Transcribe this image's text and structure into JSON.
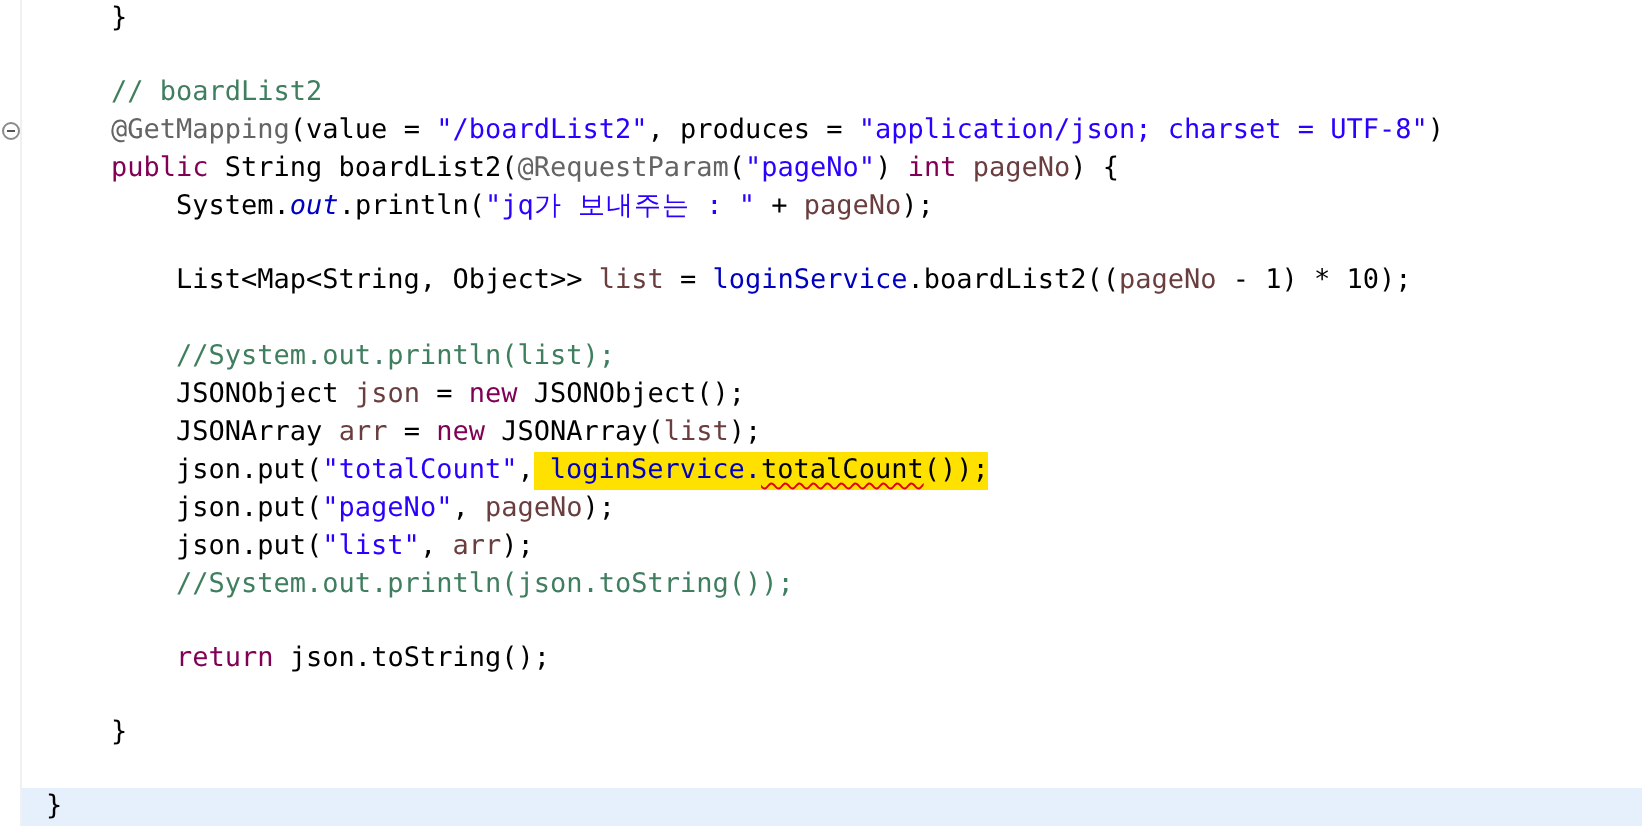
{
  "editor": {
    "lines": [
      {
        "fold": false,
        "current": false,
        "tokens": [
          {
            "text": "    }",
            "kind": "plain"
          }
        ]
      },
      {
        "fold": false,
        "current": false
      },
      {
        "fold": false,
        "current": false,
        "tokens": [
          {
            "text": "    // boardList2",
            "kind": "comment"
          }
        ]
      },
      {
        "fold": true,
        "current": false,
        "tokens": [
          {
            "text": "    @GetMapping",
            "kind": "annotation"
          },
          {
            "text": "(value = ",
            "kind": "plain"
          },
          {
            "text": "\"/boardList2\"",
            "kind": "string"
          },
          {
            "text": ", produces = ",
            "kind": "plain"
          },
          {
            "text": "\"application/json; charset = UTF-8\"",
            "kind": "string"
          },
          {
            "text": ")",
            "kind": "plain"
          }
        ]
      },
      {
        "fold": false,
        "current": false,
        "tokens": [
          {
            "text": "    public",
            "kind": "keyword"
          },
          {
            "text": " String boardList2(",
            "kind": "plain"
          },
          {
            "text": "@RequestParam",
            "kind": "annotation"
          },
          {
            "text": "(",
            "kind": "plain"
          },
          {
            "text": "\"pageNo\"",
            "kind": "string"
          },
          {
            "text": ") ",
            "kind": "plain"
          },
          {
            "text": "int",
            "kind": "keyword"
          },
          {
            "text": " pageNo",
            "kind": "variable"
          },
          {
            "text": ") {",
            "kind": "plain"
          }
        ]
      },
      {
        "fold": false,
        "current": false,
        "tokens": [
          {
            "text": "        System.",
            "kind": "plain"
          },
          {
            "text": "out",
            "kind": "static"
          },
          {
            "text": ".println(",
            "kind": "plain"
          },
          {
            "text": "\"jq가 보내주는 : \"",
            "kind": "string"
          },
          {
            "text": " + ",
            "kind": "plain"
          },
          {
            "text": "pageNo",
            "kind": "variable"
          },
          {
            "text": ");",
            "kind": "plain"
          }
        ]
      },
      {
        "fold": false,
        "current": false
      },
      {
        "fold": false,
        "current": false,
        "tokens": [
          {
            "text": "        List<Map<String, Object>> ",
            "kind": "plain"
          },
          {
            "text": "list",
            "kind": "variable"
          },
          {
            "text": " = ",
            "kind": "plain"
          },
          {
            "text": "loginService",
            "kind": "field"
          },
          {
            "text": ".boardList2((",
            "kind": "plain"
          },
          {
            "text": "pageNo",
            "kind": "variable"
          },
          {
            "text": " - 1) * 10);",
            "kind": "plain"
          }
        ]
      },
      {
        "fold": false,
        "current": false
      },
      {
        "fold": false,
        "current": false,
        "tokens": [
          {
            "text": "        //System.out.println(list);",
            "kind": "comment"
          }
        ]
      },
      {
        "fold": false,
        "current": false,
        "tokens": [
          {
            "text": "        JSONObject ",
            "kind": "plain"
          },
          {
            "text": "json",
            "kind": "variable"
          },
          {
            "text": " = ",
            "kind": "plain"
          },
          {
            "text": "new",
            "kind": "keyword"
          },
          {
            "text": " JSONObject();",
            "kind": "plain"
          }
        ]
      },
      {
        "fold": false,
        "current": false,
        "tokens": [
          {
            "text": "        JSONArray ",
            "kind": "plain"
          },
          {
            "text": "arr",
            "kind": "variable"
          },
          {
            "text": " = ",
            "kind": "plain"
          },
          {
            "text": "new",
            "kind": "keyword"
          },
          {
            "text": " JSONArray(",
            "kind": "plain"
          },
          {
            "text": "list",
            "kind": "variable"
          },
          {
            "text": ");",
            "kind": "plain"
          }
        ]
      },
      {
        "fold": false,
        "current": false,
        "tokens": [
          {
            "text": "        json",
            "kind": "plain"
          },
          {
            "text": ".put(",
            "kind": "plain"
          },
          {
            "text": "\"totalCount\"",
            "kind": "string"
          },
          {
            "text": ",",
            "kind": "plain"
          }
        ],
        "highlight": [
          {
            "text": "loginService.",
            "kind": "field"
          },
          {
            "text": "totalCount",
            "kind": "warning"
          },
          {
            "text": "());",
            "kind": "plain"
          }
        ]
      },
      {
        "fold": false,
        "current": false,
        "tokens": [
          {
            "text": "        json.put(",
            "kind": "plain"
          },
          {
            "text": "\"pageNo\"",
            "kind": "string"
          },
          {
            "text": ", ",
            "kind": "plain"
          },
          {
            "text": "pageNo",
            "kind": "variable"
          },
          {
            "text": ");",
            "kind": "plain"
          }
        ]
      },
      {
        "fold": false,
        "current": false,
        "tokens": [
          {
            "text": "        json.put(",
            "kind": "plain"
          },
          {
            "text": "\"list\"",
            "kind": "string"
          },
          {
            "text": ", ",
            "kind": "plain"
          },
          {
            "text": "arr",
            "kind": "variable"
          },
          {
            "text": ");",
            "kind": "plain"
          }
        ]
      },
      {
        "fold": false,
        "current": false,
        "tokens": [
          {
            "text": "        //System.out.println(json.toString());",
            "kind": "comment"
          }
        ]
      },
      {
        "fold": false,
        "current": false
      },
      {
        "fold": false,
        "current": false,
        "tokens": [
          {
            "text": "        return",
            "kind": "keyword"
          },
          {
            "text": " json.toString();",
            "kind": "plain"
          }
        ]
      },
      {
        "fold": false,
        "current": false
      },
      {
        "fold": false,
        "current": false,
        "tokens": [
          {
            "text": "    }",
            "kind": "plain"
          }
        ]
      },
      {
        "fold": false,
        "current": false
      },
      {
        "fold": false,
        "current": true,
        "tokens": [
          {
            "text": "}",
            "kind": "plain"
          }
        ]
      }
    ]
  }
}
